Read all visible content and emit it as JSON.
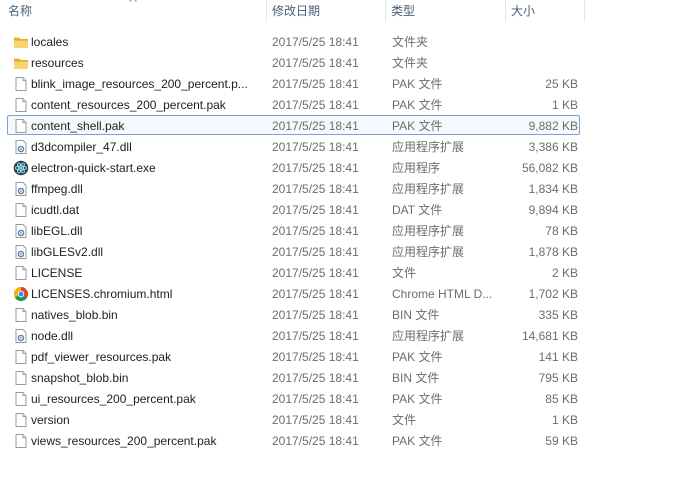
{
  "columns": {
    "name": "名称",
    "date": "修改日期",
    "type": "类型",
    "size": "大小"
  },
  "files": [
    {
      "name": "locales",
      "date": "2017/5/25 18:41",
      "type": "文件夹",
      "size": "",
      "icon": "folder-icon"
    },
    {
      "name": "resources",
      "date": "2017/5/25 18:41",
      "type": "文件夹",
      "size": "",
      "icon": "folder-icon"
    },
    {
      "name": "blink_image_resources_200_percent.p...",
      "date": "2017/5/25 18:41",
      "type": "PAK 文件",
      "size": "25 KB",
      "icon": "file-icon"
    },
    {
      "name": "content_resources_200_percent.pak",
      "date": "2017/5/25 18:41",
      "type": "PAK 文件",
      "size": "1 KB",
      "icon": "file-icon"
    },
    {
      "name": "content_shell.pak",
      "date": "2017/5/25 18:41",
      "type": "PAK 文件",
      "size": "9,882 KB",
      "icon": "file-icon",
      "selected": true
    },
    {
      "name": "d3dcompiler_47.dll",
      "date": "2017/5/25 18:41",
      "type": "应用程序扩展",
      "size": "3,386 KB",
      "icon": "dll-icon"
    },
    {
      "name": "electron-quick-start.exe",
      "date": "2017/5/25 18:41",
      "type": "应用程序",
      "size": "56,082 KB",
      "icon": "electron-icon"
    },
    {
      "name": "ffmpeg.dll",
      "date": "2017/5/25 18:41",
      "type": "应用程序扩展",
      "size": "1,834 KB",
      "icon": "dll-icon"
    },
    {
      "name": "icudtl.dat",
      "date": "2017/5/25 18:41",
      "type": "DAT 文件",
      "size": "9,894 KB",
      "icon": "file-icon"
    },
    {
      "name": "libEGL.dll",
      "date": "2017/5/25 18:41",
      "type": "应用程序扩展",
      "size": "78 KB",
      "icon": "dll-icon"
    },
    {
      "name": "libGLESv2.dll",
      "date": "2017/5/25 18:41",
      "type": "应用程序扩展",
      "size": "1,878 KB",
      "icon": "dll-icon"
    },
    {
      "name": "LICENSE",
      "date": "2017/5/25 18:41",
      "type": "文件",
      "size": "2 KB",
      "icon": "file-icon"
    },
    {
      "name": "LICENSES.chromium.html",
      "date": "2017/5/25 18:41",
      "type": "Chrome HTML D...",
      "size": "1,702 KB",
      "icon": "chrome-icon"
    },
    {
      "name": "natives_blob.bin",
      "date": "2017/5/25 18:41",
      "type": "BIN 文件",
      "size": "335 KB",
      "icon": "file-icon"
    },
    {
      "name": "node.dll",
      "date": "2017/5/25 18:41",
      "type": "应用程序扩展",
      "size": "14,681 KB",
      "icon": "dll-icon"
    },
    {
      "name": "pdf_viewer_resources.pak",
      "date": "2017/5/25 18:41",
      "type": "PAK 文件",
      "size": "141 KB",
      "icon": "file-icon"
    },
    {
      "name": "snapshot_blob.bin",
      "date": "2017/5/25 18:41",
      "type": "BIN 文件",
      "size": "795 KB",
      "icon": "file-icon"
    },
    {
      "name": "ui_resources_200_percent.pak",
      "date": "2017/5/25 18:41",
      "type": "PAK 文件",
      "size": "85 KB",
      "icon": "file-icon"
    },
    {
      "name": "version",
      "date": "2017/5/25 18:41",
      "type": "文件",
      "size": "1 KB",
      "icon": "file-icon"
    },
    {
      "name": "views_resources_200_percent.pak",
      "date": "2017/5/25 18:41",
      "type": "PAK 文件",
      "size": "59 KB",
      "icon": "file-icon"
    }
  ]
}
